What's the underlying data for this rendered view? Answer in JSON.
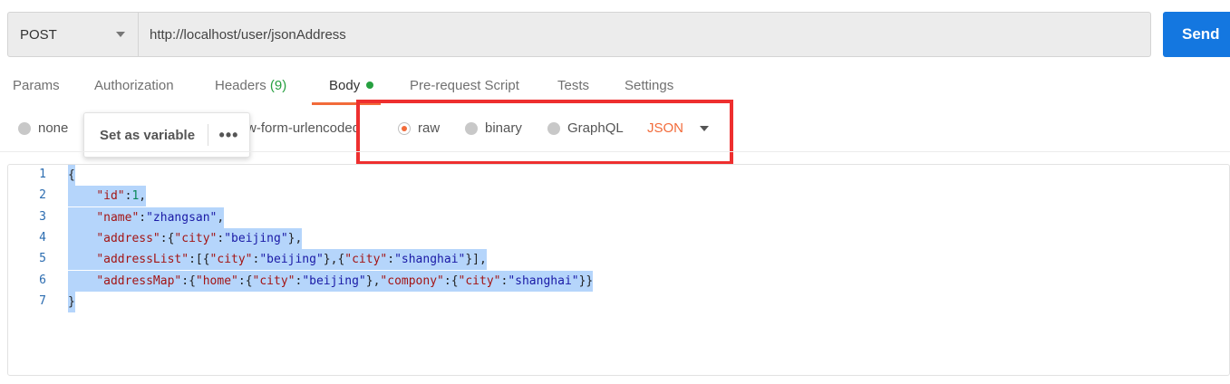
{
  "request": {
    "method": "POST",
    "url": "http://localhost/user/jsonAddress",
    "send_label": "Send"
  },
  "tabs": {
    "params": "Params",
    "authorization": "Authorization",
    "headers": "Headers",
    "headers_count": "(9)",
    "body": "Body",
    "prerequest": "Pre-request Script",
    "tests": "Tests",
    "settings": "Settings"
  },
  "body_types": {
    "none": "none",
    "urlencoded_partial": "w-form-urlencoded",
    "raw": "raw",
    "binary": "binary",
    "graphql": "GraphQL",
    "selected": "raw",
    "format": "JSON"
  },
  "popup": {
    "label": "Set as variable",
    "more": "•••"
  },
  "colors": {
    "accent": "#f26b3a",
    "send": "#1477e0",
    "selection": "#b5d5fb",
    "highlight_box": "#ee2f2f"
  },
  "editor": {
    "lines": [
      {
        "n": "1",
        "text": "{"
      },
      {
        "n": "2",
        "text": "    \"id\":1,"
      },
      {
        "n": "3",
        "text": "    \"name\":\"zhangsan\","
      },
      {
        "n": "4",
        "text": "    \"address\":{\"city\":\"beijing\"},"
      },
      {
        "n": "5",
        "text": "    \"addressList\":[{\"city\":\"beijing\"},{\"city\":\"shanghai\"}],"
      },
      {
        "n": "6",
        "text": "    \"addressMap\":{\"home\":{\"city\":\"beijing\"},\"compony\":{\"city\":\"shanghai\"}}"
      },
      {
        "n": "7",
        "text": "}"
      }
    ]
  }
}
